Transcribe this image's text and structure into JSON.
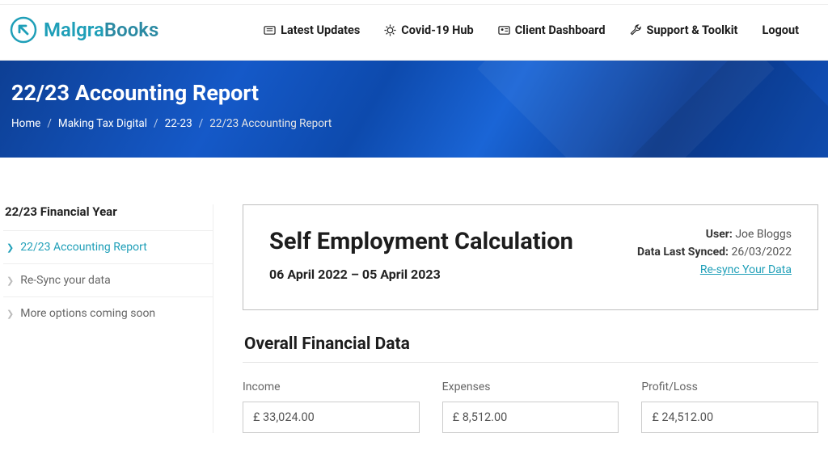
{
  "brand": {
    "name1": "Malgra",
    "name2": "Books"
  },
  "nav": {
    "updates": "Latest Updates",
    "covid": "Covid-19 Hub",
    "dashboard": "Client Dashboard",
    "support": "Support & Toolkit",
    "logout": "Logout"
  },
  "hero": {
    "title": "22/23 Accounting Report",
    "crumbs": {
      "home": "Home",
      "mtd": "Making Tax Digital",
      "year": "22-23",
      "current": "22/23 Accounting Report"
    }
  },
  "sidebar": {
    "heading": "22/23 Financial Year",
    "report": "22/23 Accounting Report",
    "resync": "Re-Sync your data",
    "more": "More options coming soon"
  },
  "card": {
    "title": "Self Employment Calculation",
    "period": "06 April 2022 – 05 April 2023",
    "user_label": "User:",
    "user_value": "Joe Bloggs",
    "synced_label": "Data Last Synced:",
    "synced_value": "26/03/2022",
    "resync": "Re-sync Your Data"
  },
  "overall": {
    "title": "Overall Financial Data",
    "income_label": "Income",
    "income_value": "£ 33,024.00",
    "expenses_label": "Expenses",
    "expenses_value": "£ 8,512.00",
    "profit_label": "Profit/Loss",
    "profit_value": "£ 24,512.00"
  }
}
